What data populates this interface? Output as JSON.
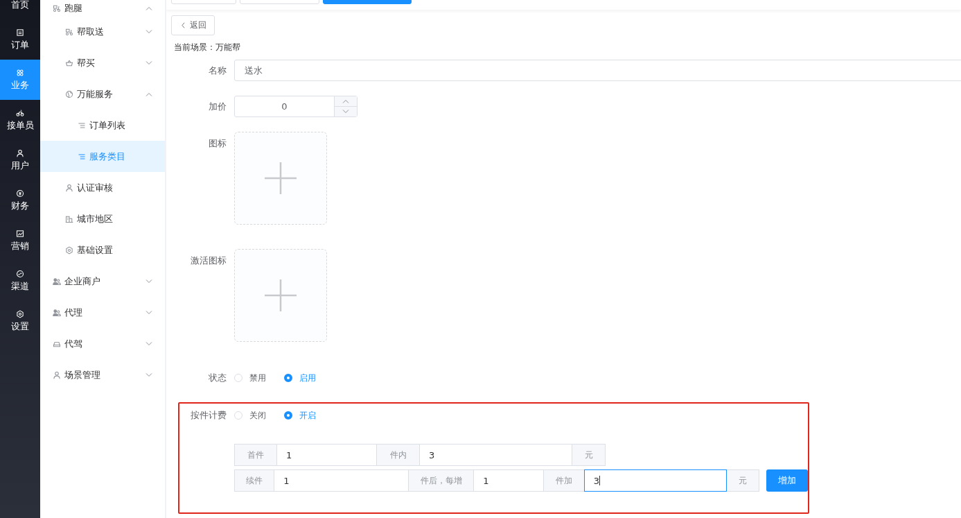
{
  "rail": [
    {
      "label": "首页",
      "kind": "home",
      "selected": false
    },
    {
      "label": "订单",
      "kind": "order",
      "selected": false
    },
    {
      "label": "业务",
      "kind": "grid",
      "selected": true
    },
    {
      "label": "接单员",
      "kind": "bike",
      "selected": false
    },
    {
      "label": "用户",
      "kind": "user",
      "selected": false
    },
    {
      "label": "财务",
      "kind": "coin",
      "selected": false
    },
    {
      "label": "营销",
      "kind": "chart",
      "selected": false
    },
    {
      "label": "渠道",
      "kind": "link",
      "selected": false
    },
    {
      "label": "设置",
      "kind": "gear",
      "selected": false
    }
  ],
  "submenu": [
    {
      "label": "跑腿",
      "kind": "scooter",
      "expanded": true,
      "selected": false,
      "children": [
        {
          "label": "帮取送",
          "kind": "scooter",
          "expanded": false,
          "selected": false
        },
        {
          "label": "帮买",
          "kind": "basket",
          "expanded": false,
          "selected": false
        },
        {
          "label": "万能服务",
          "kind": "globe",
          "expanded": true,
          "selected": false,
          "children": [
            {
              "label": "订单列表",
              "kind": "list",
              "selected": false
            },
            {
              "label": "服务类目",
              "kind": "list",
              "selected": true
            }
          ]
        },
        {
          "label": "认证审核",
          "kind": "user",
          "selected": false
        },
        {
          "label": "城市地区",
          "kind": "building",
          "selected": false
        },
        {
          "label": "基础设置",
          "kind": "gear",
          "selected": false
        }
      ]
    },
    {
      "label": "企业商户",
      "kind": "users",
      "expanded": false,
      "selected": false
    },
    {
      "label": "代理",
      "kind": "users",
      "expanded": false,
      "selected": false
    },
    {
      "label": "代驾",
      "kind": "car",
      "expanded": false,
      "selected": false
    },
    {
      "label": "场景管理",
      "kind": "user",
      "expanded": false,
      "selected": false
    }
  ],
  "back_button": "返回",
  "scene": "当前场景：万能帮",
  "name_field": {
    "label": "名称",
    "value": "送水"
  },
  "price_field": {
    "label": "加价",
    "value": "0"
  },
  "uploads": [
    {
      "label": "图标"
    },
    {
      "label": "激活图标"
    }
  ],
  "status": {
    "label": "状态",
    "options": [
      {
        "label": "禁用",
        "selected": false
      },
      {
        "label": "启用",
        "selected": true
      }
    ]
  },
  "piece_billing": {
    "label": "按件计费",
    "options": [
      {
        "label": "关闭",
        "selected": false
      },
      {
        "label": "开启",
        "selected": true
      }
    ],
    "first_tier": {
      "parts": [
        {
          "kind": "addon",
          "text": "首件"
        },
        {
          "kind": "input",
          "text": "1",
          "focused": false
        },
        {
          "kind": "addon",
          "text": "件内"
        },
        {
          "kind": "input",
          "text": "3",
          "focused": false
        },
        {
          "kind": "addon",
          "text": "元"
        }
      ]
    },
    "extra_tier": {
      "parts": [
        {
          "kind": "addon",
          "text": "续件"
        },
        {
          "kind": "input",
          "text": "1",
          "focused": false
        },
        {
          "kind": "addon",
          "text": "件后，每增"
        },
        {
          "kind": "input",
          "text": "1",
          "focused": false
        },
        {
          "kind": "addon",
          "text": "件加"
        },
        {
          "kind": "input",
          "text": "3",
          "focused": true
        },
        {
          "kind": "addon",
          "text": "元"
        }
      ],
      "button": "增加"
    }
  }
}
